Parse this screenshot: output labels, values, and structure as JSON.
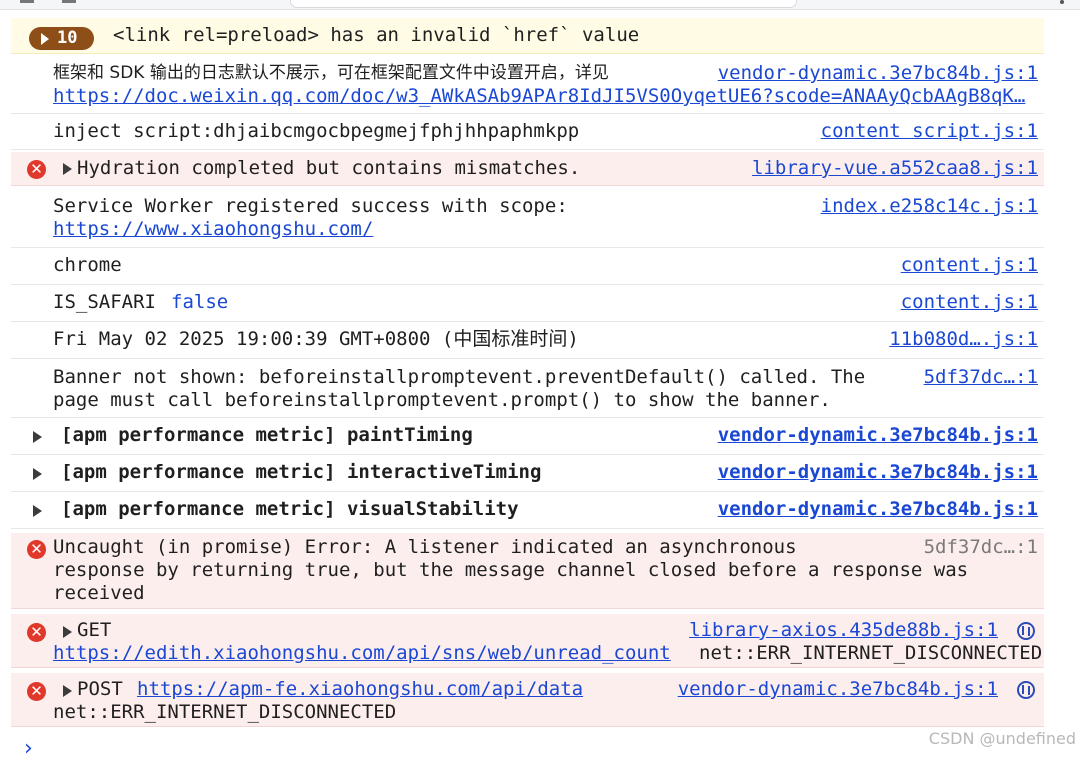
{
  "warning_group": {
    "count": "10",
    "message": "<link rel=preload> has an invalid `href` value"
  },
  "messages": [
    {
      "text": "框架和 SDK 输出的日志默认不展示，可在框架配置文件中设置开启，详见",
      "link": "https://doc.weixin.qq.com/doc/w3_AWkASAb9APAr8IdJI5VS0OyqetUE6?scode=ANAAyQcbAAgB8qK…",
      "source": "vendor-dynamic.3e7bc84b.js:1"
    },
    {
      "text": "inject script:dhjaibcmgocbpegmejfphjhhpaphmkpp",
      "source": "content script.js:1"
    },
    {
      "text": "Hydration completed but contains mismatches.",
      "source": "library-vue.a552caa8.js:1"
    },
    {
      "text": "Service Worker registered success with scope:",
      "link": "https://www.xiaohongshu.com/",
      "source": "index.e258c14c.js:1"
    },
    {
      "text": "chrome",
      "source": "content.js:1"
    },
    {
      "text": "IS_SAFARI",
      "value": "false",
      "source": "content.js:1"
    },
    {
      "text": "Fri May 02 2025 19:00:39 GMT+0800 (中国标准时间)",
      "source": "11b080d….js:1"
    },
    {
      "text_line1": "Banner not shown: beforeinstallpromptevent.preventDefault() called. The",
      "text_line2": "page must call beforeinstallpromptevent.prompt() to show the banner.",
      "source": "5df37dc…:1"
    },
    {
      "text": "[apm performance metric] paintTiming",
      "source": "vendor-dynamic.3e7bc84b.js:1"
    },
    {
      "text": "[apm performance metric] interactiveTiming",
      "source": "vendor-dynamic.3e7bc84b.js:1"
    },
    {
      "text": "[apm performance metric] visualStability",
      "source": "vendor-dynamic.3e7bc84b.js:1"
    },
    {
      "text_line1": "Uncaught (in promise) Error: A listener indicated an asynchronous",
      "text_line2": "response by returning true, but the message channel closed before a response was",
      "text_line3": "received",
      "source": "5df37dc…:1"
    },
    {
      "method": "GET",
      "link": "https://edith.xiaohongshu.com/api/sns/web/unread_count",
      "status": "net::ERR_INTERNET_DISCONNECTED",
      "source": "library-axios.435de88b.js:1"
    },
    {
      "method": "POST",
      "link": "https://apm-fe.xiaohongshu.com/api/data",
      "status": "net::ERR_INTERNET_DISCONNECTED",
      "source": "vendor-dynamic.3e7bc84b.js:1"
    }
  ],
  "prompt_symbol": "›",
  "watermark": "CSDN @undefined",
  "icons": {
    "error": "error-circle-icon",
    "network": "network-request-icon",
    "expand": "expand-triangle-icon"
  },
  "colors": {
    "warning_bg": "#fffbe5",
    "error_bg": "#fdeeee",
    "link": "#1a47d3",
    "badge": "#8d4e17",
    "error_icon": "#e0392b"
  }
}
